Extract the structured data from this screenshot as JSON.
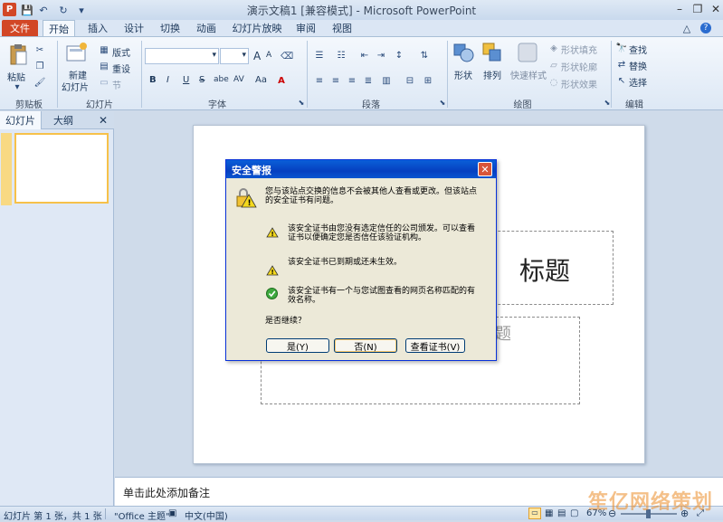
{
  "window": {
    "title": "演示文稿1 [兼容模式] - Microsoft PowerPoint"
  },
  "tabs": [
    "文件",
    "开始",
    "插入",
    "设计",
    "切换",
    "动画",
    "幻灯片放映",
    "审阅",
    "视图"
  ],
  "ribbon": {
    "clipboard": {
      "paste": "粘贴",
      "group": "剪贴板"
    },
    "slides": {
      "new_slide_1": "新建",
      "new_slide_2": "幻灯片",
      "layout": "版式",
      "reset": "重设",
      "section": "节",
      "group": "幻灯片"
    },
    "font": {
      "group": "字体",
      "bold": "B",
      "italic": "I",
      "underline": "U",
      "strike": "S",
      "shadow": "abe",
      "grow": "A",
      "shrink": "A",
      "spacing": "AV",
      "case": "Aa"
    },
    "paragraph": {
      "group": "段落"
    },
    "drawing": {
      "shape": "形状",
      "arrange": "排列",
      "quick_styles": "快速样式",
      "fill": "形状填充",
      "outline": "形状轮廓",
      "effects": "形状效果",
      "group": "绘图"
    },
    "editing": {
      "find": "查找",
      "replace": "替换",
      "select": "选择",
      "group": "编辑"
    }
  },
  "left_panel": {
    "tab_slides": "幻灯片",
    "tab_outline": "大纲",
    "slide_number": "1"
  },
  "slide": {
    "title_fragment": "标题",
    "subtitle_fragment": "题"
  },
  "notes": {
    "placeholder": "单击此处添加备注"
  },
  "status": {
    "slide_info": "幻灯片 第 1 张，共 1 张",
    "theme": "\"Office 主题\"",
    "language": "中文(中国)",
    "zoom": "67%"
  },
  "dialog": {
    "title": "安全警报",
    "intro": [
      "您与该站点交换的信息不会被其他人查看或更改。但该站点",
      "的安全证书有问题。"
    ],
    "item1": [
      "该安全证书由您没有选定信任的公司颁发。可以查看",
      "证书以便确定您是否信任该验证机构。"
    ],
    "item2": [
      "该安全证书已到期或还未生效。"
    ],
    "item3": [
      "该安全证书有一个与您试图查看的网页名称匹配的有",
      "效名称。"
    ],
    "question": "是否继续？",
    "btn_yes": "是(Y)",
    "btn_no": "否(N)",
    "btn_view": "查看证书(V)"
  },
  "watermark": "笙亿网络策划",
  "colors": {
    "file_tab": "#d24726",
    "dialog_title": "#0a5fd8",
    "ribbon_bg": "#dde8f5"
  }
}
